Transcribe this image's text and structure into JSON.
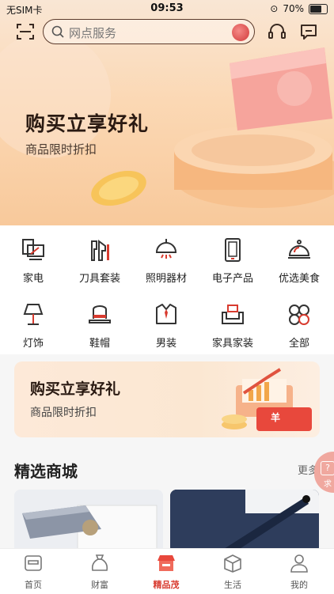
{
  "status_bar": {
    "carrier": "无SIM卡",
    "time": "09:53",
    "battery": "70%"
  },
  "search": {
    "placeholder": "网点服务"
  },
  "hero": {
    "title": "购买立享好礼",
    "subtitle": "商品限时折扣"
  },
  "categories": [
    {
      "label": "家电",
      "icon": "appliance-icon"
    },
    {
      "label": "刀具套装",
      "icon": "knife-set-icon"
    },
    {
      "label": "照明器材",
      "icon": "ceiling-lamp-icon"
    },
    {
      "label": "电子产品",
      "icon": "phone-icon"
    },
    {
      "label": "优选美食",
      "icon": "food-cloche-icon"
    },
    {
      "label": "灯饰",
      "icon": "table-lamp-icon"
    },
    {
      "label": "鞋帽",
      "icon": "hat-icon"
    },
    {
      "label": "男装",
      "icon": "shirt-icon"
    },
    {
      "label": "家具家装",
      "icon": "sofa-icon"
    },
    {
      "label": "全部",
      "icon": "all-grid-icon"
    }
  ],
  "promo_banner": {
    "title": "购买立享好礼",
    "subtitle": "商品限时折扣",
    "coin_symbol": "羊"
  },
  "section": {
    "title": "精选商城",
    "more": "更多",
    "float_badge": "求"
  },
  "tabs": [
    {
      "label": "首页",
      "icon": "home-icon",
      "active": false
    },
    {
      "label": "财富",
      "icon": "wealth-bag-icon",
      "active": false
    },
    {
      "label": "精品茂",
      "icon": "store-icon",
      "active": true
    },
    {
      "label": "生活",
      "icon": "life-box-icon",
      "active": false
    },
    {
      "label": "我的",
      "icon": "user-icon",
      "active": false
    }
  ],
  "colors": {
    "accent": "#d83b2f",
    "hero_bg": "#fbd8b4",
    "banner_bg": "#fde9d8"
  }
}
